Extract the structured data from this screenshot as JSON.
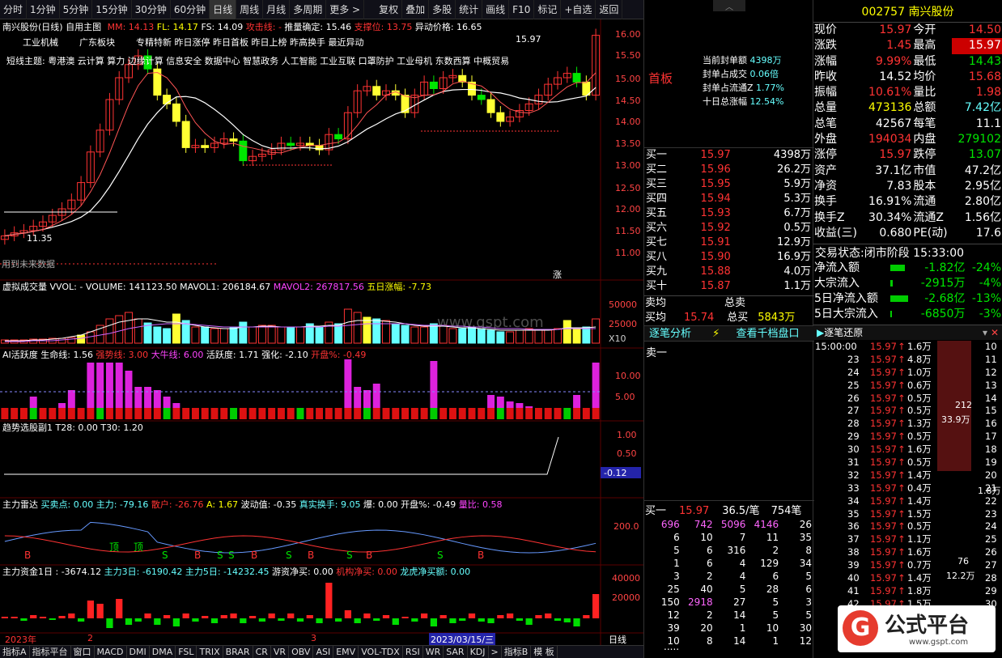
{
  "toolbar": {
    "left": [
      "分时",
      "1分钟",
      "5分钟",
      "15分钟",
      "30分钟",
      "60分钟",
      "日线",
      "周线",
      "月线",
      "多周期",
      "更多 >"
    ],
    "right": [
      "复权",
      "叠加",
      "多股",
      "统计",
      "画线",
      "F10",
      "标记",
      "+自选",
      "返回"
    ]
  },
  "main": {
    "title": "南兴股份(日线)",
    "tag": "自用主图",
    "mm": "MM: 14.13",
    "fl": "FL: 14.17",
    "fs": "FS: 14.09",
    "gjx": "攻击线: -",
    "tjqd": "推量确定: 15.46",
    "zcw": "支撑位: 13.75",
    "ydjg": "异动价格: 16.65",
    "tags1": [
      "工业机械",
      "广东板块",
      "专精特新 昨日涨停 昨日首板 昨日上榜 昨高换手 最近异动"
    ],
    "tags2": "短线主题: 粤港澳 云计算 算力 边缘计算 信息安全 数据中心 智慧政务 人工智能 工业互联 口罩防护 工业母机 东数西算 中概贸易",
    "hi": "15.97",
    "lo": "11.35",
    "note": "用到未来数据",
    "rise": "涨",
    "yaxis": [
      "16.00",
      "15.50",
      "15.00",
      "14.50",
      "14.00",
      "13.50",
      "13.00",
      "12.50",
      "12.00",
      "11.50",
      "11.00"
    ],
    "seal": [
      [
        "当前封单额",
        "4398万"
      ],
      [
        "封单占成交",
        "0.06倍"
      ],
      [
        "封单占流通Z",
        "1.77%"
      ],
      [
        "十日总涨幅",
        "12.54%"
      ]
    ],
    "first": "首板"
  },
  "vol": {
    "title": "虚拟成交量",
    "vvol": "VVOL: -",
    "volume": "VOLUME: 141123.50",
    "mavol1": "MAVOL1: 206184.67",
    "mavol2": "MAVOL2: 267817.56",
    "five": "五日涨幅: -7.73",
    "yaxis": [
      "50000",
      "25000",
      "X10"
    ]
  },
  "ai": {
    "title": "AI活跃度",
    "smx": "生命线: 1.56",
    "qsx": "强势线: 3.00",
    "dnx": "大牛线: 6.00",
    "hyd": "活跃度: 1.71",
    "qh": "强化: -2.10",
    "kp": "开盘%: -0.49",
    "yaxis": [
      "10.00",
      "5.00"
    ]
  },
  "trend": {
    "title": "趋势选股副1",
    "t28": "T28: 0.00",
    "t30": "T30: 1.20",
    "yaxis": [
      "1.00",
      "0.50",
      "0.00",
      "-0.12"
    ]
  },
  "radar": {
    "title": "主力雷达",
    "mmd": "买卖点: 0.00",
    "zl": "主力: -79.16",
    "sh": "散户: -26.76",
    "a": "A: 1.67",
    "bdz": "波动值: -0.35",
    "zshs": "真实换手: 9.05",
    "bao": "爆: 0.00",
    "kp": "开盘%: -0.49",
    "lb": "量比: 0.58",
    "yaxis": [
      "200.0"
    ],
    "letters": [
      "B",
      "顶",
      "顶",
      "S",
      "B",
      "S",
      "S",
      "B",
      "S",
      "B",
      "S",
      "B",
      "S",
      "B"
    ]
  },
  "fund": {
    "title": "主力资金1日",
    "v1": ": -3674.12",
    "zl3": "主力3日: -6190.42",
    "zl5": "主力5日: -14232.45",
    "yz": "游资净买: 0.00",
    "jg": "机构净买: 0.00",
    "lh": "龙虎净买额: 0.00",
    "yaxis": [
      "40000",
      "20000"
    ]
  },
  "dates": [
    "2023年",
    "2",
    "3",
    "2023/03/15/三"
  ],
  "bottom": [
    "指标A",
    "指标平台",
    "窗口",
    "MACD",
    "DMI",
    "DMA",
    "FSL",
    "TRIX",
    "BRAR",
    "CR",
    "VR",
    "OBV",
    "ASI",
    "EMV",
    "VOL-TDX",
    "RSI",
    "WR",
    "SAR",
    "KDJ",
    ">",
    "指标B",
    "模 板"
  ],
  "day_btn": "日线",
  "quote": {
    "code": "002757",
    "name": "南兴股份",
    "rows": [
      [
        "现价",
        "15.97",
        "今开",
        "14.50"
      ],
      [
        "涨跌",
        "1.45",
        "最高",
        "15.97"
      ],
      [
        "涨幅",
        "9.99%",
        "最低",
        "14.43"
      ],
      [
        "昨收",
        "14.52",
        "均价",
        "15.68"
      ],
      [
        "振幅",
        "10.61%",
        "量比",
        "1.98"
      ],
      [
        "总量",
        "473136",
        "总额",
        "7.42亿"
      ],
      [
        "总笔",
        "42567",
        "每笔",
        "11.1"
      ],
      [
        "外盘",
        "194034",
        "内盘",
        "279102"
      ],
      [
        "涨停",
        "15.97",
        "跌停",
        "13.07"
      ],
      [
        "资产",
        "37.1亿",
        "市值",
        "47.2亿"
      ],
      [
        "净资",
        "7.83",
        "股本",
        "2.95亿"
      ],
      [
        "换手",
        "16.91%",
        "流通",
        "2.80亿"
      ],
      [
        "换手Z",
        "30.34%",
        "流通Z",
        "1.56亿"
      ],
      [
        "收益(三)",
        "0.680",
        "PE(动)",
        "17.6"
      ]
    ],
    "status_label": "交易状态:",
    "status": "闭市阶段",
    "time": "15:33:00",
    "flows": [
      [
        "净流入额",
        "-1.82亿",
        "-24%"
      ],
      [
        "大宗流入",
        "-2915万",
        "-4%"
      ],
      [
        "5日净流入额",
        "-2.68亿",
        "-13%"
      ],
      [
        "5日大宗流入",
        "-6850万",
        "-3%"
      ]
    ]
  },
  "book": {
    "bids": [
      [
        "买一",
        "15.97",
        "4398万"
      ],
      [
        "买二",
        "15.96",
        "26.2万"
      ],
      [
        "买三",
        "15.95",
        "5.9万"
      ],
      [
        "买四",
        "15.94",
        "5.3万"
      ],
      [
        "买五",
        "15.93",
        "6.7万"
      ],
      [
        "买六",
        "15.92",
        "0.5万"
      ],
      [
        "买七",
        "15.91",
        "12.9万"
      ],
      [
        "买八",
        "15.90",
        "16.9万"
      ],
      [
        "买九",
        "15.88",
        "4.0万"
      ],
      [
        "买十",
        "15.87",
        "1.1万"
      ]
    ],
    "sell_avg": "卖均",
    "buy_avg": "买均",
    "avg": "15.74",
    "total_sell": "总卖",
    "total_buy": "总买",
    "tb": "5843万",
    "tabs": [
      "逐笔分析",
      "查看千档盘口"
    ],
    "sell1": "卖一",
    "buy1": "买一",
    "b1p": "15.97",
    "b1v": "36.5/笔",
    "b1n": "754笔",
    "grid": [
      [
        "696",
        "742",
        "5096",
        "4146",
        "26"
      ],
      [
        "6",
        "10",
        "7",
        "11",
        "35"
      ],
      [
        "5",
        "6",
        "316",
        "2",
        "8"
      ],
      [
        "1",
        "6",
        "4",
        "129",
        "34"
      ],
      [
        "3",
        "2",
        "4",
        "6",
        "5"
      ],
      [
        "25",
        "40",
        "5",
        "28",
        "6"
      ],
      [
        "150",
        "2918",
        "27",
        "5",
        "3"
      ],
      [
        "12",
        "2",
        "14",
        "5",
        "5"
      ],
      [
        "39",
        "20",
        "1",
        "10",
        "30"
      ],
      [
        "10",
        "8",
        "14",
        "1",
        "12"
      ]
    ],
    "more": "....."
  },
  "ticks": {
    "title": "逐笔还原",
    "rows": [
      [
        "15:00:00",
        "15.97",
        "1.6万"
      ],
      [
        "23",
        "15.97",
        "4.8万"
      ],
      [
        "24",
        "15.97",
        "1.0万"
      ],
      [
        "25",
        "15.97",
        "0.6万"
      ],
      [
        "26",
        "15.97",
        "0.5万"
      ],
      [
        "27",
        "15.97",
        "0.5万"
      ],
      [
        "28",
        "15.97",
        "1.3万"
      ],
      [
        "29",
        "15.97",
        "0.5万"
      ],
      [
        "30",
        "15.97",
        "1.6万"
      ],
      [
        "31",
        "15.97",
        "0.5万"
      ],
      [
        "32",
        "15.97",
        "1.4万"
      ],
      [
        "33",
        "15.97",
        "0.4万"
      ],
      [
        "34",
        "15.97",
        "1.4万"
      ],
      [
        "35",
        "15.97",
        "1.5万"
      ],
      [
        "36",
        "15.97",
        "0.5万"
      ],
      [
        "37",
        "15.97",
        "1.1万"
      ],
      [
        "38",
        "15.97",
        "1.6万"
      ],
      [
        "39",
        "15.97",
        "0.7万"
      ],
      [
        "40",
        "15.97",
        "1.4万"
      ],
      [
        "41",
        "15.97",
        "1.8万"
      ],
      [
        "42",
        "15.97",
        "1.5万"
      ]
    ],
    "big1": "212",
    "big2": "33.9万",
    "big3": "76",
    "big4": "12.2万",
    "side": "1.8万",
    "right": [
      "10",
      "11",
      "12",
      "13",
      "14",
      "15",
      "16",
      "17",
      "18",
      "19",
      "20",
      "21",
      "22",
      "23",
      "24",
      "25",
      "26",
      "27",
      "28",
      "29",
      "30"
    ]
  },
  "logo": {
    "text": "公式平台",
    "url": "www.gspt.com",
    "wm": "www.gspt.com"
  },
  "colors": {
    "up": "#ff3333",
    "down": "#00e600",
    "bg": "#000000"
  }
}
